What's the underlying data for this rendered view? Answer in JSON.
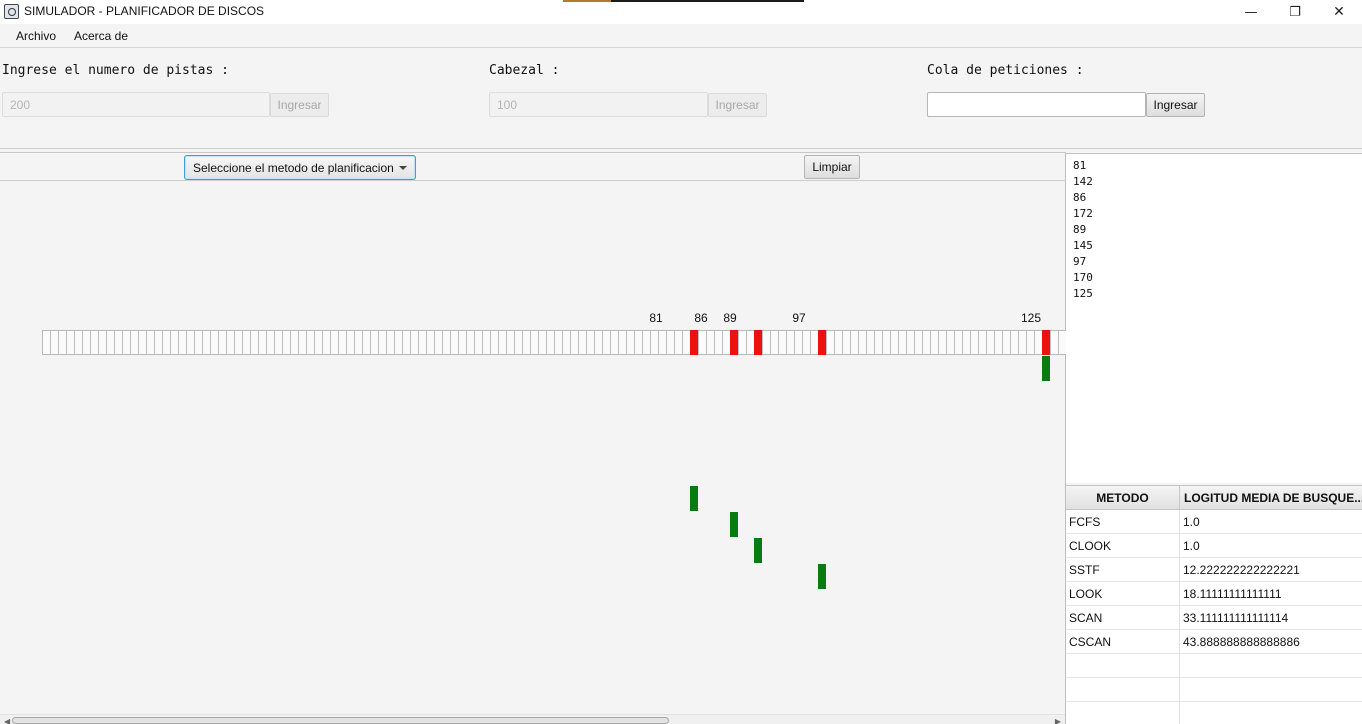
{
  "window": {
    "title": "SIMULADOR - PLANIFICADOR DE DISCOS",
    "minimize_glyph": "—",
    "maximize_glyph": "❐",
    "close_glyph": "✕"
  },
  "menu": {
    "archivo": "Archivo",
    "acerca": "Acerca de"
  },
  "inputs": {
    "pistas": {
      "label": "Ingrese el numero de pistas :",
      "value": "200",
      "button": "Ingresar"
    },
    "cabezal": {
      "label": "Cabezal :",
      "value": "100",
      "button": "Ingresar"
    },
    "cola": {
      "label": "Cola de peticiones :",
      "value": "",
      "button": "Ingresar"
    }
  },
  "planner": {
    "method_combo": "Seleccione el metodo de planificacion",
    "clear_button": "Limpiar",
    "request_labels": [
      "81",
      "86",
      "89",
      "97",
      "125"
    ]
  },
  "queue": [
    "81",
    "142",
    "86",
    "172",
    "89",
    "145",
    "97",
    "170",
    "125"
  ],
  "results": {
    "headers": [
      "METODO",
      "LOGITUD MEDIA DE BUSQUE..."
    ],
    "rows": [
      {
        "method": "FCFS",
        "value": "1.0"
      },
      {
        "method": "CLOOK",
        "value": "1.0"
      },
      {
        "method": "SSTF",
        "value": "12.222222222222221"
      },
      {
        "method": "LOOK",
        "value": "18.11111111111111"
      },
      {
        "method": "SCAN",
        "value": "33.111111111111114"
      },
      {
        "method": "CSCAN",
        "value": "43.888888888888886"
      }
    ]
  },
  "colors": {
    "request_mark": "#ee1111",
    "head_path_mark": "#0a7a12",
    "focus_border": "#3d9fd4"
  }
}
